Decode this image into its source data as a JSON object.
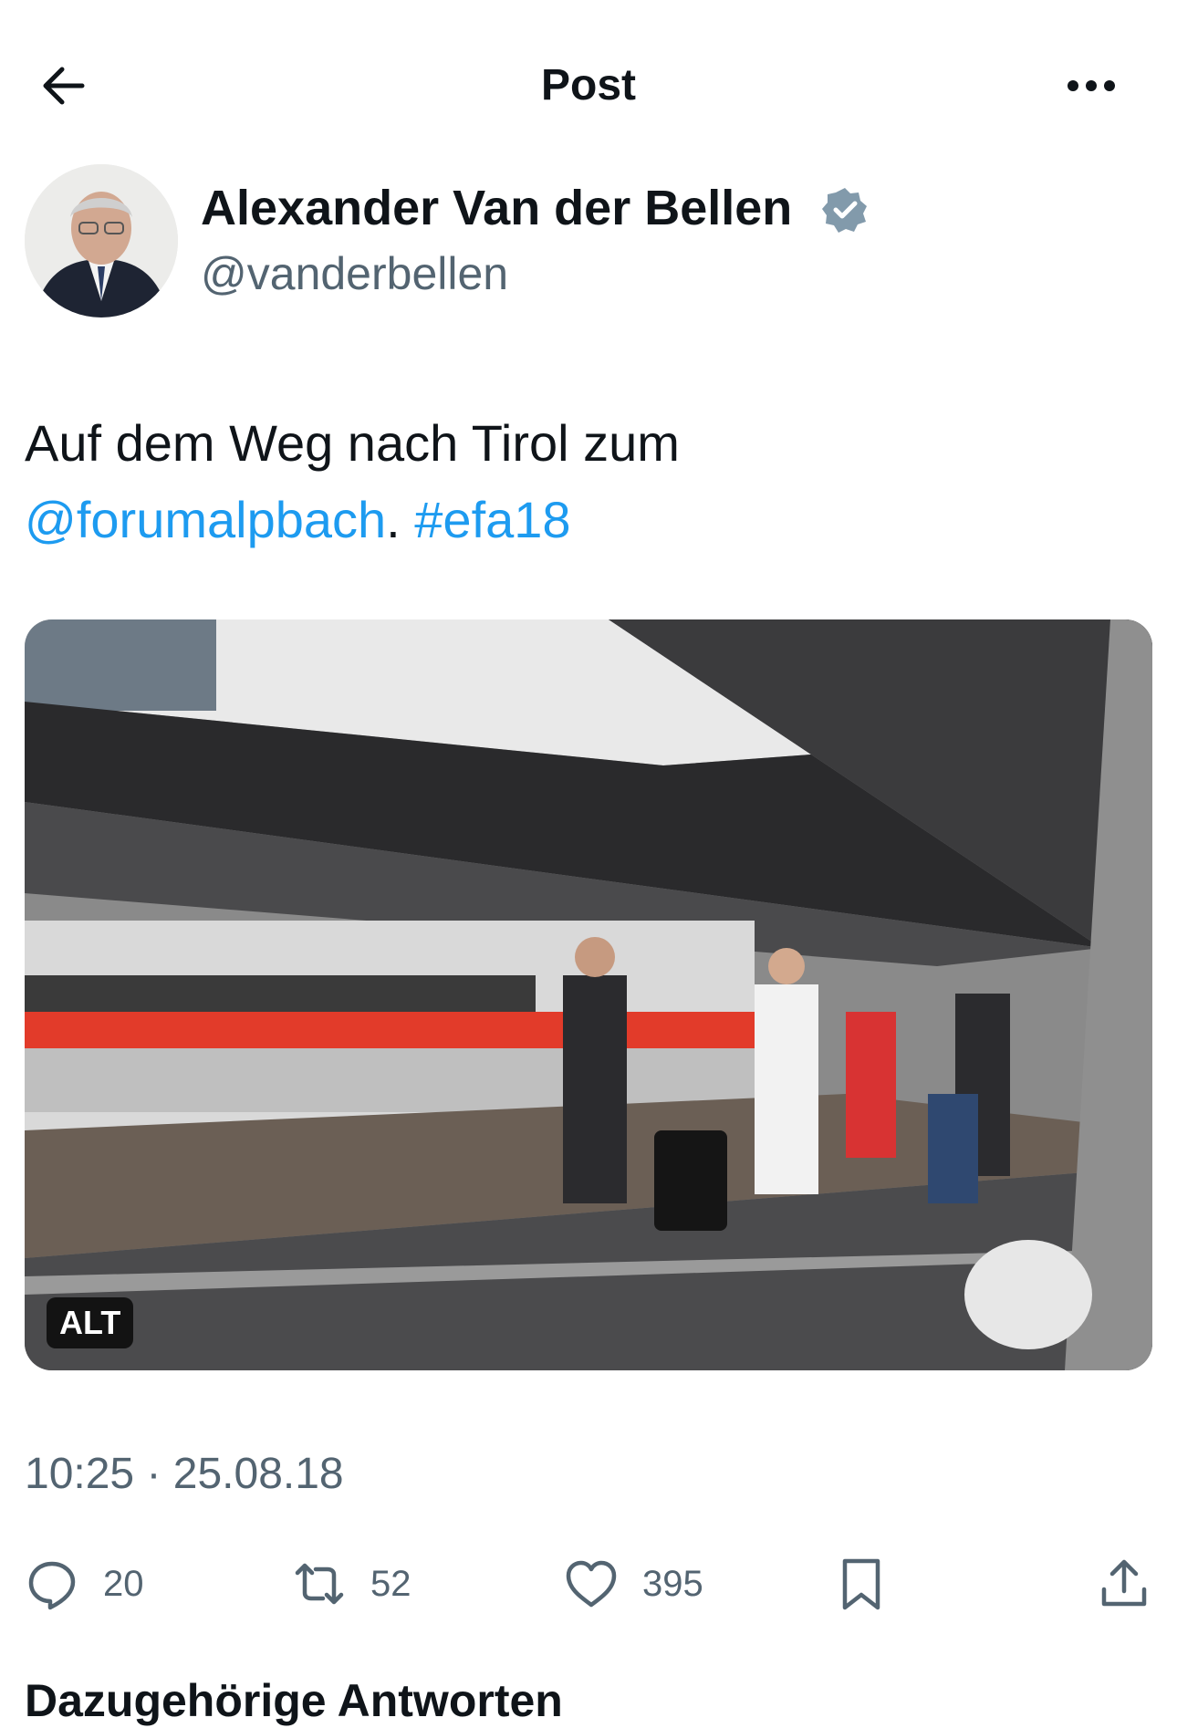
{
  "header": {
    "title": "Post",
    "back_icon": "arrow-left-icon",
    "more_icon": "more-horizontal-icon"
  },
  "author": {
    "name": "Alexander Van der Bellen",
    "handle": "@vanderbellen",
    "verified_color": "#829aab"
  },
  "post": {
    "text_part1": "Auf dem Weg nach Tirol zum",
    "mention": "@forumalpbach",
    "separator": ".",
    "hashtag": "#efa18",
    "link_color": "#1d9bf0"
  },
  "media": {
    "alt_label": "ALT"
  },
  "meta": {
    "timestamp": "10:25 · 25.08.18"
  },
  "actions": {
    "replies": "20",
    "reposts": "52",
    "likes": "395"
  },
  "bottom_cutoff_text": "Dazugehörige Antworten"
}
